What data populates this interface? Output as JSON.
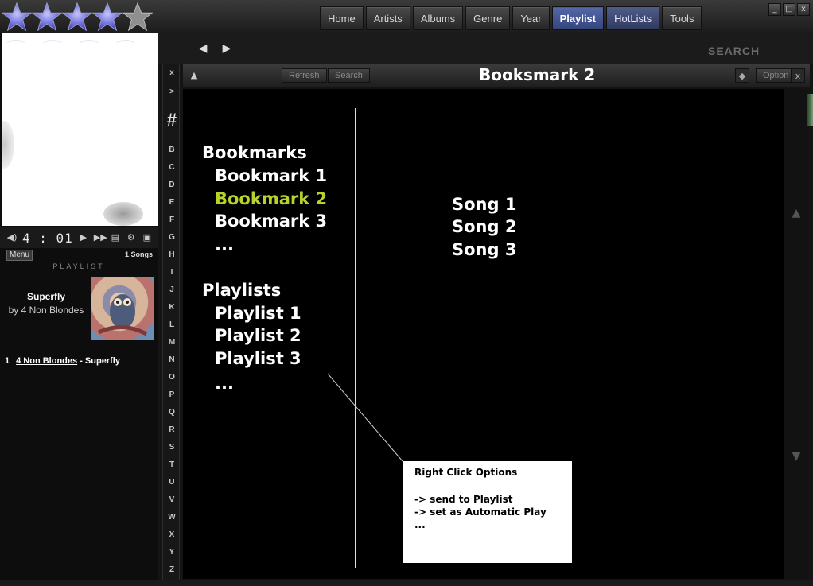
{
  "rating": {
    "stars_filled": 4,
    "stars_total": 5
  },
  "tabs": [
    "Home",
    "Artists",
    "Albums",
    "Genre",
    "Year",
    "Playlist",
    "HotLists",
    "Tools"
  ],
  "active_tab": "Playlist",
  "window_buttons": {
    "minimize": "_",
    "maximize": "□",
    "close": "x"
  },
  "player": {
    "time": "4 : 01",
    "menu_label": "Menu",
    "song_count": "1 Songs",
    "playlist_header": "PLAYLIST",
    "now_playing": {
      "title": "Superfly",
      "artist_line": "by 4 Non Blondes"
    },
    "playlist": [
      {
        "num": "1",
        "artist": "4 Non Blondes",
        "sep": " - ",
        "title": "Superfly"
      }
    ]
  },
  "alphabet": [
    "x",
    ">",
    "#",
    "B",
    "C",
    "D",
    "E",
    "F",
    "G",
    "H",
    "I",
    "J",
    "K",
    "L",
    "M",
    "N",
    "O",
    "P",
    "Q",
    "R",
    "S",
    "T",
    "U",
    "V",
    "W",
    "X",
    "Y",
    "Z"
  ],
  "nav": {
    "search_label": "SEARCH"
  },
  "content_header": {
    "refresh": "Refresh",
    "search": "Search",
    "title": "Booksmark 2",
    "option": "Option",
    "close": "x"
  },
  "tree": {
    "bookmarks_heading": "Bookmarks",
    "bookmarks": [
      "Bookmark 1",
      "Bookmark 2",
      "Bookmark 3",
      "..."
    ],
    "selected_bookmark": "Bookmark 2",
    "playlists_heading": "Playlists",
    "playlists": [
      "Playlist 1",
      "Playlist 2",
      "Playlist 3",
      "..."
    ]
  },
  "songs": [
    "Song 1",
    "Song 2",
    "Song 3"
  ],
  "callout": {
    "title": "Right Click Options",
    "lines": [
      "-> send to Playlist",
      "-> set as Automatic Play",
      "..."
    ]
  },
  "colors": {
    "accent_selected": "#b8d22c",
    "tab_active": "#3b4d8a"
  }
}
